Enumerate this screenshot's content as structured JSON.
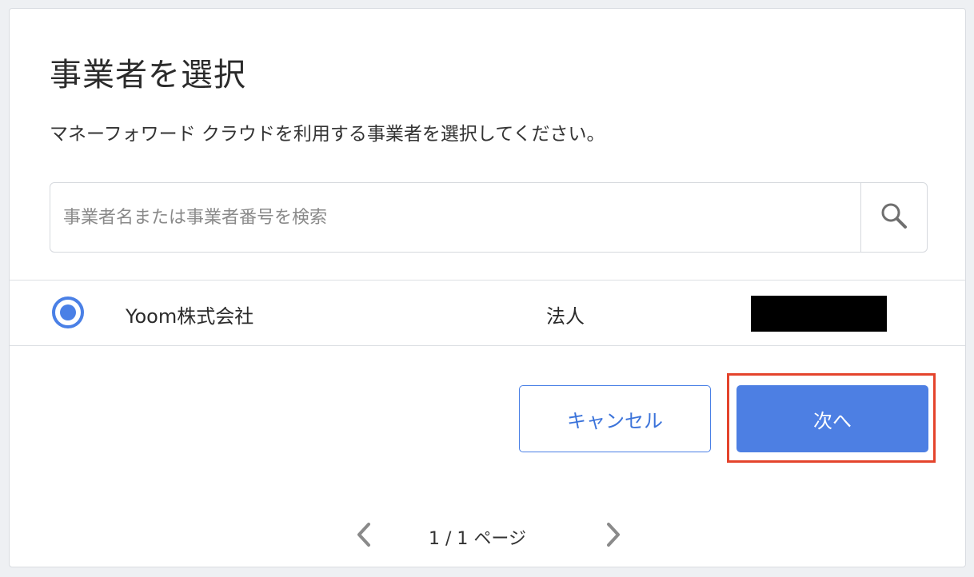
{
  "dialog": {
    "title": "事業者を選択",
    "description": "マネーフォワード クラウドを利用する事業者を選択してください。"
  },
  "search": {
    "placeholder": "事業者名または事業者番号を検索",
    "value": "",
    "icon": "search-icon"
  },
  "businesses": [
    {
      "name": "Yoom株式会社",
      "type": "法人",
      "selected": true
    }
  ],
  "buttons": {
    "cancel_label": "キャンセル",
    "next_label": "次へ"
  },
  "pagination": {
    "label": "1 / 1 ページ",
    "prev_icon": "chevron-left-icon",
    "next_icon": "chevron-right-icon"
  },
  "colors": {
    "accent": "#4d7fe3",
    "highlight": "#e4442c",
    "redaction": "#000000"
  }
}
